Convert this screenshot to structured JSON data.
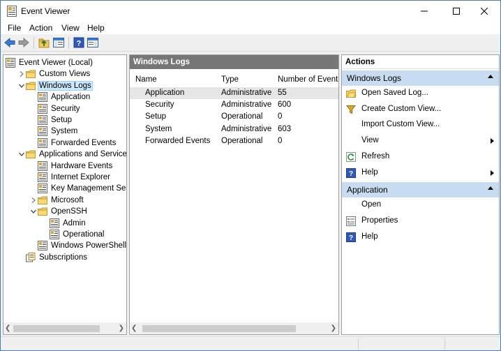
{
  "window": {
    "title": "Event Viewer"
  },
  "menu": [
    "File",
    "Action",
    "View",
    "Help"
  ],
  "tree": [
    {
      "label": "Event Viewer (Local)",
      "icon": "event-viewer-icon",
      "chev": "",
      "indent": 0
    },
    {
      "label": "Custom Views",
      "icon": "folder-icon",
      "chev": "right",
      "indent": 1
    },
    {
      "label": "Windows Logs",
      "icon": "folder-icon",
      "chev": "down",
      "indent": 1,
      "selected": true
    },
    {
      "label": "Application",
      "icon": "log-icon",
      "chev": "",
      "indent": 2
    },
    {
      "label": "Security",
      "icon": "log-icon",
      "chev": "",
      "indent": 2
    },
    {
      "label": "Setup",
      "icon": "log-icon",
      "chev": "",
      "indent": 2
    },
    {
      "label": "System",
      "icon": "log-icon",
      "chev": "",
      "indent": 2
    },
    {
      "label": "Forwarded Events",
      "icon": "log-icon",
      "chev": "",
      "indent": 2
    },
    {
      "label": "Applications and Services Lo",
      "icon": "folder-icon",
      "chev": "down",
      "indent": 1
    },
    {
      "label": "Hardware Events",
      "icon": "log-icon",
      "chev": "",
      "indent": 2
    },
    {
      "label": "Internet Explorer",
      "icon": "log-icon",
      "chev": "",
      "indent": 2
    },
    {
      "label": "Key Management Service",
      "icon": "log-icon",
      "chev": "",
      "indent": 2
    },
    {
      "label": "Microsoft",
      "icon": "folder-icon",
      "chev": "right",
      "indent": 2
    },
    {
      "label": "OpenSSH",
      "icon": "folder-icon",
      "chev": "down",
      "indent": 2
    },
    {
      "label": "Admin",
      "icon": "log-icon",
      "chev": "",
      "indent": 3
    },
    {
      "label": "Operational",
      "icon": "log-icon",
      "chev": "",
      "indent": 3
    },
    {
      "label": "Windows PowerShell",
      "icon": "log-icon",
      "chev": "",
      "indent": 2
    },
    {
      "label": "Subscriptions",
      "icon": "subscriptions-icon",
      "chev": "",
      "indent": 1
    }
  ],
  "center": {
    "title": "Windows Logs",
    "columns": [
      "Name",
      "Type",
      "Number of Events"
    ],
    "rows": [
      {
        "name": "Application",
        "type": "Administrative",
        "count": "55",
        "selected": true
      },
      {
        "name": "Security",
        "type": "Administrative",
        "count": "600"
      },
      {
        "name": "Setup",
        "type": "Operational",
        "count": "0"
      },
      {
        "name": "System",
        "type": "Administrative",
        "count": "603"
      },
      {
        "name": "Forwarded Events",
        "type": "Operational",
        "count": "0"
      }
    ]
  },
  "actions": {
    "title": "Actions",
    "sections": [
      {
        "title": "Windows Logs",
        "items": [
          {
            "label": "Open Saved Log...",
            "icon": "open-log-icon",
            "submenu": false
          },
          {
            "label": "Create Custom View...",
            "icon": "filter-icon",
            "submenu": false
          },
          {
            "label": "Import Custom View...",
            "icon": "",
            "submenu": false
          },
          {
            "label": "View",
            "icon": "",
            "submenu": true
          },
          {
            "label": "Refresh",
            "icon": "refresh-icon",
            "submenu": false
          },
          {
            "label": "Help",
            "icon": "help-icon",
            "submenu": true
          }
        ]
      },
      {
        "title": "Application",
        "items": [
          {
            "label": "Open",
            "icon": "",
            "submenu": false
          },
          {
            "label": "Properties",
            "icon": "properties-icon",
            "submenu": false
          },
          {
            "label": "Help",
            "icon": "help-icon",
            "submenu": false
          }
        ]
      }
    ]
  },
  "colors": {
    "accent": "#c7dcf0",
    "selection": "#cce8ff",
    "header": "#777777"
  }
}
